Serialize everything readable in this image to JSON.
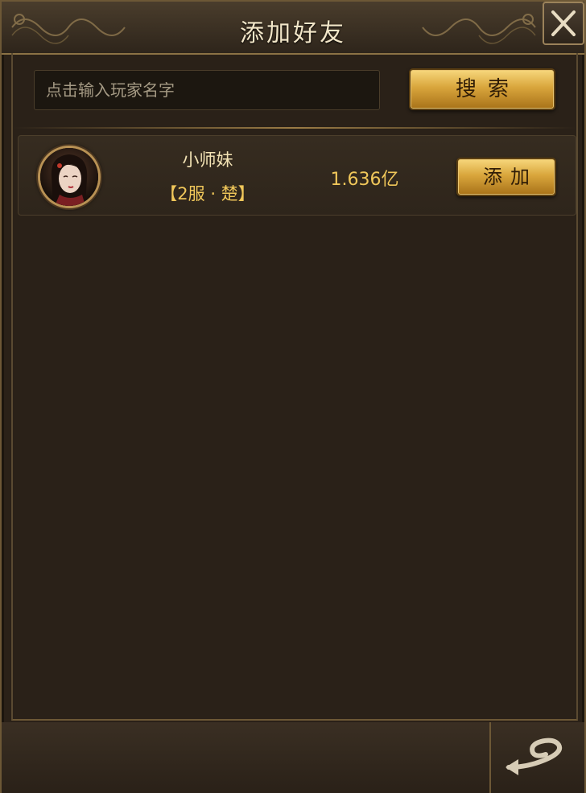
{
  "window": {
    "title": "添加好友"
  },
  "search": {
    "placeholder": "点击输入玩家名字",
    "value": "",
    "button_label": "搜索"
  },
  "results": [
    {
      "name": "小师妹",
      "server": "【2服 · 楚】",
      "power": "1.636亿",
      "add_label": "添加"
    }
  ],
  "icons": {
    "close": "close-icon",
    "return": "return-icon",
    "avatar": "female-portrait"
  },
  "colors": {
    "accent_gold": "#f0c75a",
    "panel_bg": "#2a2118",
    "border_bronze": "#8b7245"
  }
}
